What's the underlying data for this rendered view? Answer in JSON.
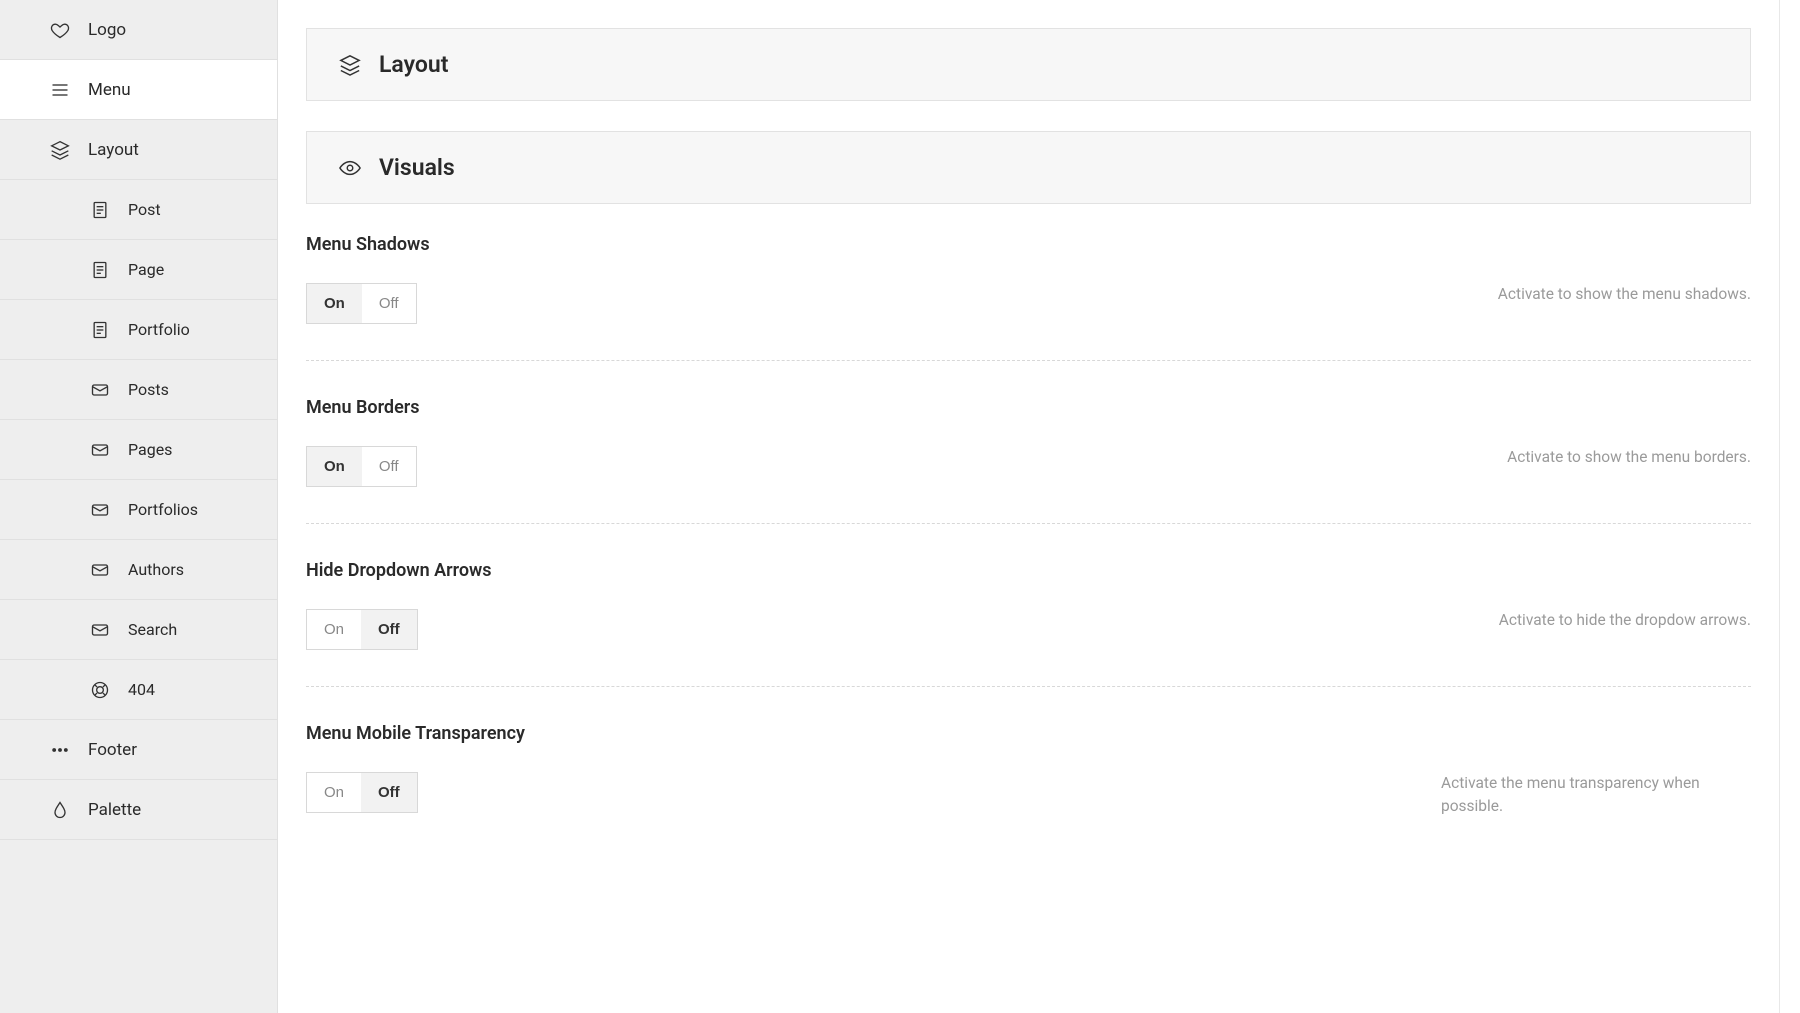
{
  "sidebar": {
    "items": [
      {
        "label": "Logo",
        "icon": "heart",
        "active": false,
        "sub": false
      },
      {
        "label": "Menu",
        "icon": "menu",
        "active": true,
        "sub": false
      },
      {
        "label": "Layout",
        "icon": "layers",
        "active": false,
        "sub": false
      },
      {
        "label": "Post",
        "icon": "doc",
        "active": false,
        "sub": true
      },
      {
        "label": "Page",
        "icon": "doc",
        "active": false,
        "sub": true
      },
      {
        "label": "Portfolio",
        "icon": "doc",
        "active": false,
        "sub": true
      },
      {
        "label": "Posts",
        "icon": "mail",
        "active": false,
        "sub": true
      },
      {
        "label": "Pages",
        "icon": "mail",
        "active": false,
        "sub": true
      },
      {
        "label": "Portfolios",
        "icon": "mail",
        "active": false,
        "sub": true
      },
      {
        "label": "Authors",
        "icon": "mail",
        "active": false,
        "sub": true
      },
      {
        "label": "Search",
        "icon": "mail",
        "active": false,
        "sub": true
      },
      {
        "label": "404",
        "icon": "help",
        "active": false,
        "sub": true
      },
      {
        "label": "Footer",
        "icon": "dots",
        "active": false,
        "sub": false
      },
      {
        "label": "Palette",
        "icon": "drop",
        "active": false,
        "sub": false
      }
    ]
  },
  "sections": {
    "layout": {
      "title": "Layout"
    },
    "visuals": {
      "title": "Visuals"
    }
  },
  "toggle_labels": {
    "on": "On",
    "off": "Off"
  },
  "settings": [
    {
      "title": "Menu Shadows",
      "value": "on",
      "desc": "Activate to show the menu shadows."
    },
    {
      "title": "Menu Borders",
      "value": "on",
      "desc": "Activate to show the menu borders."
    },
    {
      "title": "Hide Dropdown Arrows",
      "value": "off",
      "desc": "Activate to hide the dropdow arrows."
    },
    {
      "title": "Menu Mobile Transparency",
      "value": "off",
      "desc": "Activate the menu transparency when possible."
    }
  ]
}
